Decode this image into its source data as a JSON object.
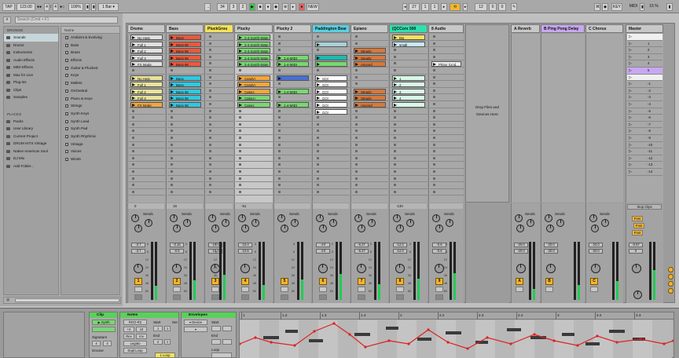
{
  "transport": {
    "tap": "TAP",
    "tempo": "123.00",
    "sig_num": "4",
    "sig_den": "4",
    "zoom": "100%",
    "quant_value": "1 Bar",
    "pos_bar": "34",
    "pos_beat": "3",
    "pos_sixteenth": "2",
    "new_label": "NEW",
    "loop_bar": "27",
    "loop_beat": "1",
    "loop_sixteenth": "1",
    "len_bar": "12",
    "len_beat": "0",
    "len_sixteenth": "0",
    "key_label": "KEY",
    "midi_label": "MIDI",
    "cpu": "15 %"
  },
  "browser": {
    "search_placeholder": "Search (Cmd + F)",
    "section_browse": "BROWSE",
    "categories": [
      "Sounds",
      "Drums",
      "Instruments",
      "Audio Effects",
      "MIDI Effects",
      "Max for Live",
      "Plug-ins",
      "Clips",
      "Samples"
    ],
    "section_places": "PLACES",
    "places": [
      "Packs",
      "User Library",
      "Current Project",
      "DRUM HITS Vintage",
      "Native American Soul",
      "DJ Mix",
      "Add Folder..."
    ],
    "name_header": "Name",
    "items": [
      "Ambient & Evolving",
      "Bass",
      "Brass",
      "Effects",
      "Guitar & Plucked",
      "Keys",
      "Mallets",
      "Orchestral",
      "Piano & Keys",
      "Strings",
      "Synth Keys",
      "Synth Lead",
      "Synth Pad",
      "Synth Rhythmic",
      "Vintage",
      "Voices",
      "Winds"
    ]
  },
  "tracks": [
    {
      "name": "Drums",
      "color": "#c8c8c8",
      "clips": [
        {
          "row": 0,
          "name": "No Hats",
          "color": "#e0e0e0"
        },
        {
          "row": 1,
          "name": "Full 1",
          "color": "#e0e0e0"
        },
        {
          "row": 2,
          "name": "Full 2",
          "color": "#e0e0e0"
        },
        {
          "row": 3,
          "name": "Full 3",
          "color": "#e0e0e0"
        },
        {
          "row": 4,
          "name": "FX Mode",
          "color": "#e0e0e0"
        },
        {
          "row": 6,
          "name": "No Hats",
          "color": "#e8e39a"
        },
        {
          "row": 7,
          "name": "Full 1",
          "color": "#e8e39a"
        },
        {
          "row": 8,
          "name": "Full 2",
          "color": "#e8e39a"
        },
        {
          "row": 9,
          "name": "Full 3",
          "color": "#e8e39a"
        },
        {
          "row": 10,
          "name": "FX Mode",
          "color": "#f2a63c"
        }
      ],
      "send_a": "0",
      "pan": "C",
      "vol": "-3.7",
      "peak": "-3.7",
      "num": "1"
    },
    {
      "name": "Bass",
      "color": "#c8c8c8",
      "clips": [
        {
          "row": 0,
          "name": "Bass",
          "color": "#e85a3c"
        },
        {
          "row": 1,
          "name": "Bass 96",
          "color": "#e85a3c"
        },
        {
          "row": 2,
          "name": "Bass 96",
          "color": "#e85a3c"
        },
        {
          "row": 3,
          "name": "Bass 96",
          "color": "#e85a3c"
        },
        {
          "row": 4,
          "name": "Bass 96",
          "color": "#e85a3c"
        },
        {
          "row": 6,
          "name": "Bass",
          "color": "#30c8e0"
        },
        {
          "row": 7,
          "name": "Bass",
          "color": "#30c8e0"
        },
        {
          "row": 8,
          "name": "Bass 96",
          "color": "#30c8e0"
        },
        {
          "row": 9,
          "name": "Bass 96",
          "color": "#30c8e0"
        },
        {
          "row": 10,
          "name": "Bass 96",
          "color": "#30c8e0"
        }
      ],
      "send_a": "16",
      "pan": "C",
      "vol": "-0.15",
      "peak": "-0.5",
      "num": "2"
    },
    {
      "name": "PluckGrou",
      "color": "#f2e35a",
      "clips": [],
      "send_a": "",
      "pan": "C",
      "vol": "-10.4",
      "peak": "-10.4",
      "num": "3"
    },
    {
      "name": "Plucky",
      "color": "#c8c8c8",
      "clips": [
        {
          "row": 0,
          "name": "2-4-Synth-Wate",
          "color": "#78d870"
        },
        {
          "row": 1,
          "name": "2-4-Synth-Wate",
          "color": "#78d870"
        },
        {
          "row": 2,
          "name": "2-4-Synth-Wate",
          "color": "#78d870"
        },
        {
          "row": 3,
          "name": "2-4-Synth-Wate",
          "color": "#78d870"
        },
        {
          "row": 4,
          "name": "2-4-Synth-Wate",
          "color": "#78d870"
        },
        {
          "row": 6,
          "name": "Candy!",
          "color": "#f2a63c"
        },
        {
          "row": 7,
          "name": "Candy!",
          "color": "#f2a63c"
        },
        {
          "row": 8,
          "name": "Cakes",
          "color": "#f2a63c"
        },
        {
          "row": 9,
          "name": "Cakes!",
          "color": "#78d870"
        },
        {
          "row": 10,
          "name": "Cakes",
          "color": "#78d870"
        }
      ],
      "send_a": "-51",
      "pan": "C",
      "vol": "-10.4",
      "peak": "-10.6",
      "num": "4"
    },
    {
      "name": "Plucky 2",
      "color": "#c8c8c8",
      "clips": [
        {
          "row": 3,
          "name": "1-4-MIDI",
          "color": "#78d870"
        },
        {
          "row": 4,
          "name": "1-4-MIDI",
          "color": "#78d870"
        },
        {
          "row": 6,
          "name": "",
          "color": "#4a6fd0"
        },
        {
          "row": 8,
          "name": "1-4-MIDI",
          "color": "#78d870"
        },
        {
          "row": 10,
          "name": "1-4-MIDI",
          "color": "#78d870"
        }
      ],
      "send_a": "",
      "pan": "",
      "vol": "",
      "peak": "",
      "num": "5"
    },
    {
      "name": "Paddington Bear",
      "color": "#5ad0e0",
      "clips": [
        {
          "row": 1,
          "name": "",
          "color": "#a8d0d8"
        },
        {
          "row": 3,
          "name": "",
          "color": "#20b8b0"
        },
        {
          "row": 4,
          "name": "",
          "color": "#78d870"
        },
        {
          "row": 6,
          "name": "GO!",
          "color": "#ffffff"
        },
        {
          "row": 7,
          "name": "GO!",
          "color": "#ffffff"
        },
        {
          "row": 8,
          "name": "GO!",
          "color": "#ffffff"
        },
        {
          "row": 9,
          "name": "GO!",
          "color": "#ffffff"
        },
        {
          "row": 10,
          "name": "GO!",
          "color": "#ffffff"
        },
        {
          "row": 11,
          "name": "GO!",
          "color": "#ffffff"
        }
      ],
      "send_a": "",
      "pan": "C",
      "vol": "-inf",
      "peak": "-inf",
      "num": "6"
    },
    {
      "name": "Epiano",
      "color": "#c8c8c8",
      "clips": [
        {
          "row": 2,
          "name": "Steady",
          "color": "#d8783a"
        },
        {
          "row": 3,
          "name": "Steady",
          "color": "#d8783a"
        },
        {
          "row": 4,
          "name": "Ascend",
          "color": "#d8783a"
        },
        {
          "row": 8,
          "name": "Steady",
          "color": "#d8783a"
        },
        {
          "row": 9,
          "name": "Steady",
          "color": "#d8783a"
        },
        {
          "row": 10,
          "name": "Ascend",
          "color": "#d8783a"
        }
      ],
      "send_a": "",
      "pan": "C",
      "vol": "-6.27",
      "peak": "-6.27",
      "num": "7"
    },
    {
      "name": "(QCCorx 500",
      "color": "#30e0b0",
      "clips": [
        {
          "row": 0,
          "name": "Big",
          "color": "#f2e35a"
        },
        {
          "row": 1,
          "name": "small",
          "color": "#c8e8f0"
        },
        {
          "row": 6,
          "name": "1",
          "color": "#d8f8e8"
        },
        {
          "row": 7,
          "name": "2",
          "color": "#d8f8e8"
        },
        {
          "row": 8,
          "name": "3",
          "color": "#d8f8e8"
        },
        {
          "row": 9,
          "name": "4",
          "color": "#d8f8e8"
        },
        {
          "row": 10,
          "name": "",
          "color": "#d8f8e8"
        }
      ],
      "send_a": "-130",
      "pan": "C",
      "vol": "-12.0",
      "peak": "-12.0",
      "num": "8"
    },
    {
      "name": "8 Audio",
      "color": "#c8c8c8",
      "clips": [
        {
          "row": 4,
          "name": "Phiter (Und...",
          "color": "#f0f0f0"
        }
      ],
      "send_a": "",
      "pan": "C",
      "vol": "-0.6",
      "peak": "-0.6",
      "num": "9"
    }
  ],
  "drop_zone": "Drop Files and Devices Here",
  "returns": [
    {
      "name": "A Reverb",
      "color": "#c8c8c8",
      "vol": "-20.0",
      "peak": "-20.0",
      "num": "A"
    },
    {
      "name": "B Ping Pong Delay",
      "color": "#c8a8f0",
      "vol": "-20.0",
      "peak": "-20.0",
      "num": "B"
    },
    {
      "name": "C Chorus",
      "color": "#c8c8c8",
      "vol": "-20.0",
      "peak": "-20.0",
      "num": "C"
    }
  ],
  "master": {
    "name": "Master",
    "scenes": [
      "",
      "1",
      "2",
      "3",
      "4",
      "5",
      "",
      "-1",
      "-2",
      "-3",
      "-4",
      "-5",
      "-6",
      "-7",
      "-8",
      "-9",
      "-10",
      "-11",
      "-12",
      "-13",
      "-14"
    ],
    "stop_clips": "Stop Clips",
    "vol": "-0.57",
    "peak": "0",
    "cue_labels": [
      "Post",
      "Post",
      "Post"
    ]
  },
  "sends_label": "Sends",
  "fader_scale": [
    "0",
    "6",
    "12",
    "24",
    "36",
    "48",
    "60"
  ],
  "clip_panel": {
    "title": "Clip",
    "signature": "Signature",
    "groove": "Groove",
    "sig_num": "4",
    "sig_den": "4"
  },
  "notes_panel": {
    "title": "Notes",
    "start": "Start",
    "end": "End",
    "set": "Set",
    "buttons": [
      "RGO-R2",
      "+2",
      "x2",
      "Rev",
      "Inv",
      "Legato",
      "Dupl.Loop"
    ],
    "loop_label": "1 Loop"
  },
  "env_panel": {
    "title": "Envelopes",
    "device": "Device",
    "start": "Start",
    "end": "End",
    "loop": "Loop"
  },
  "ruler": [
    "1",
    "1.2",
    "1.3",
    "1.4",
    "2",
    "2.2",
    "2.3",
    "2.4",
    "3",
    "3.2",
    "3.3"
  ]
}
